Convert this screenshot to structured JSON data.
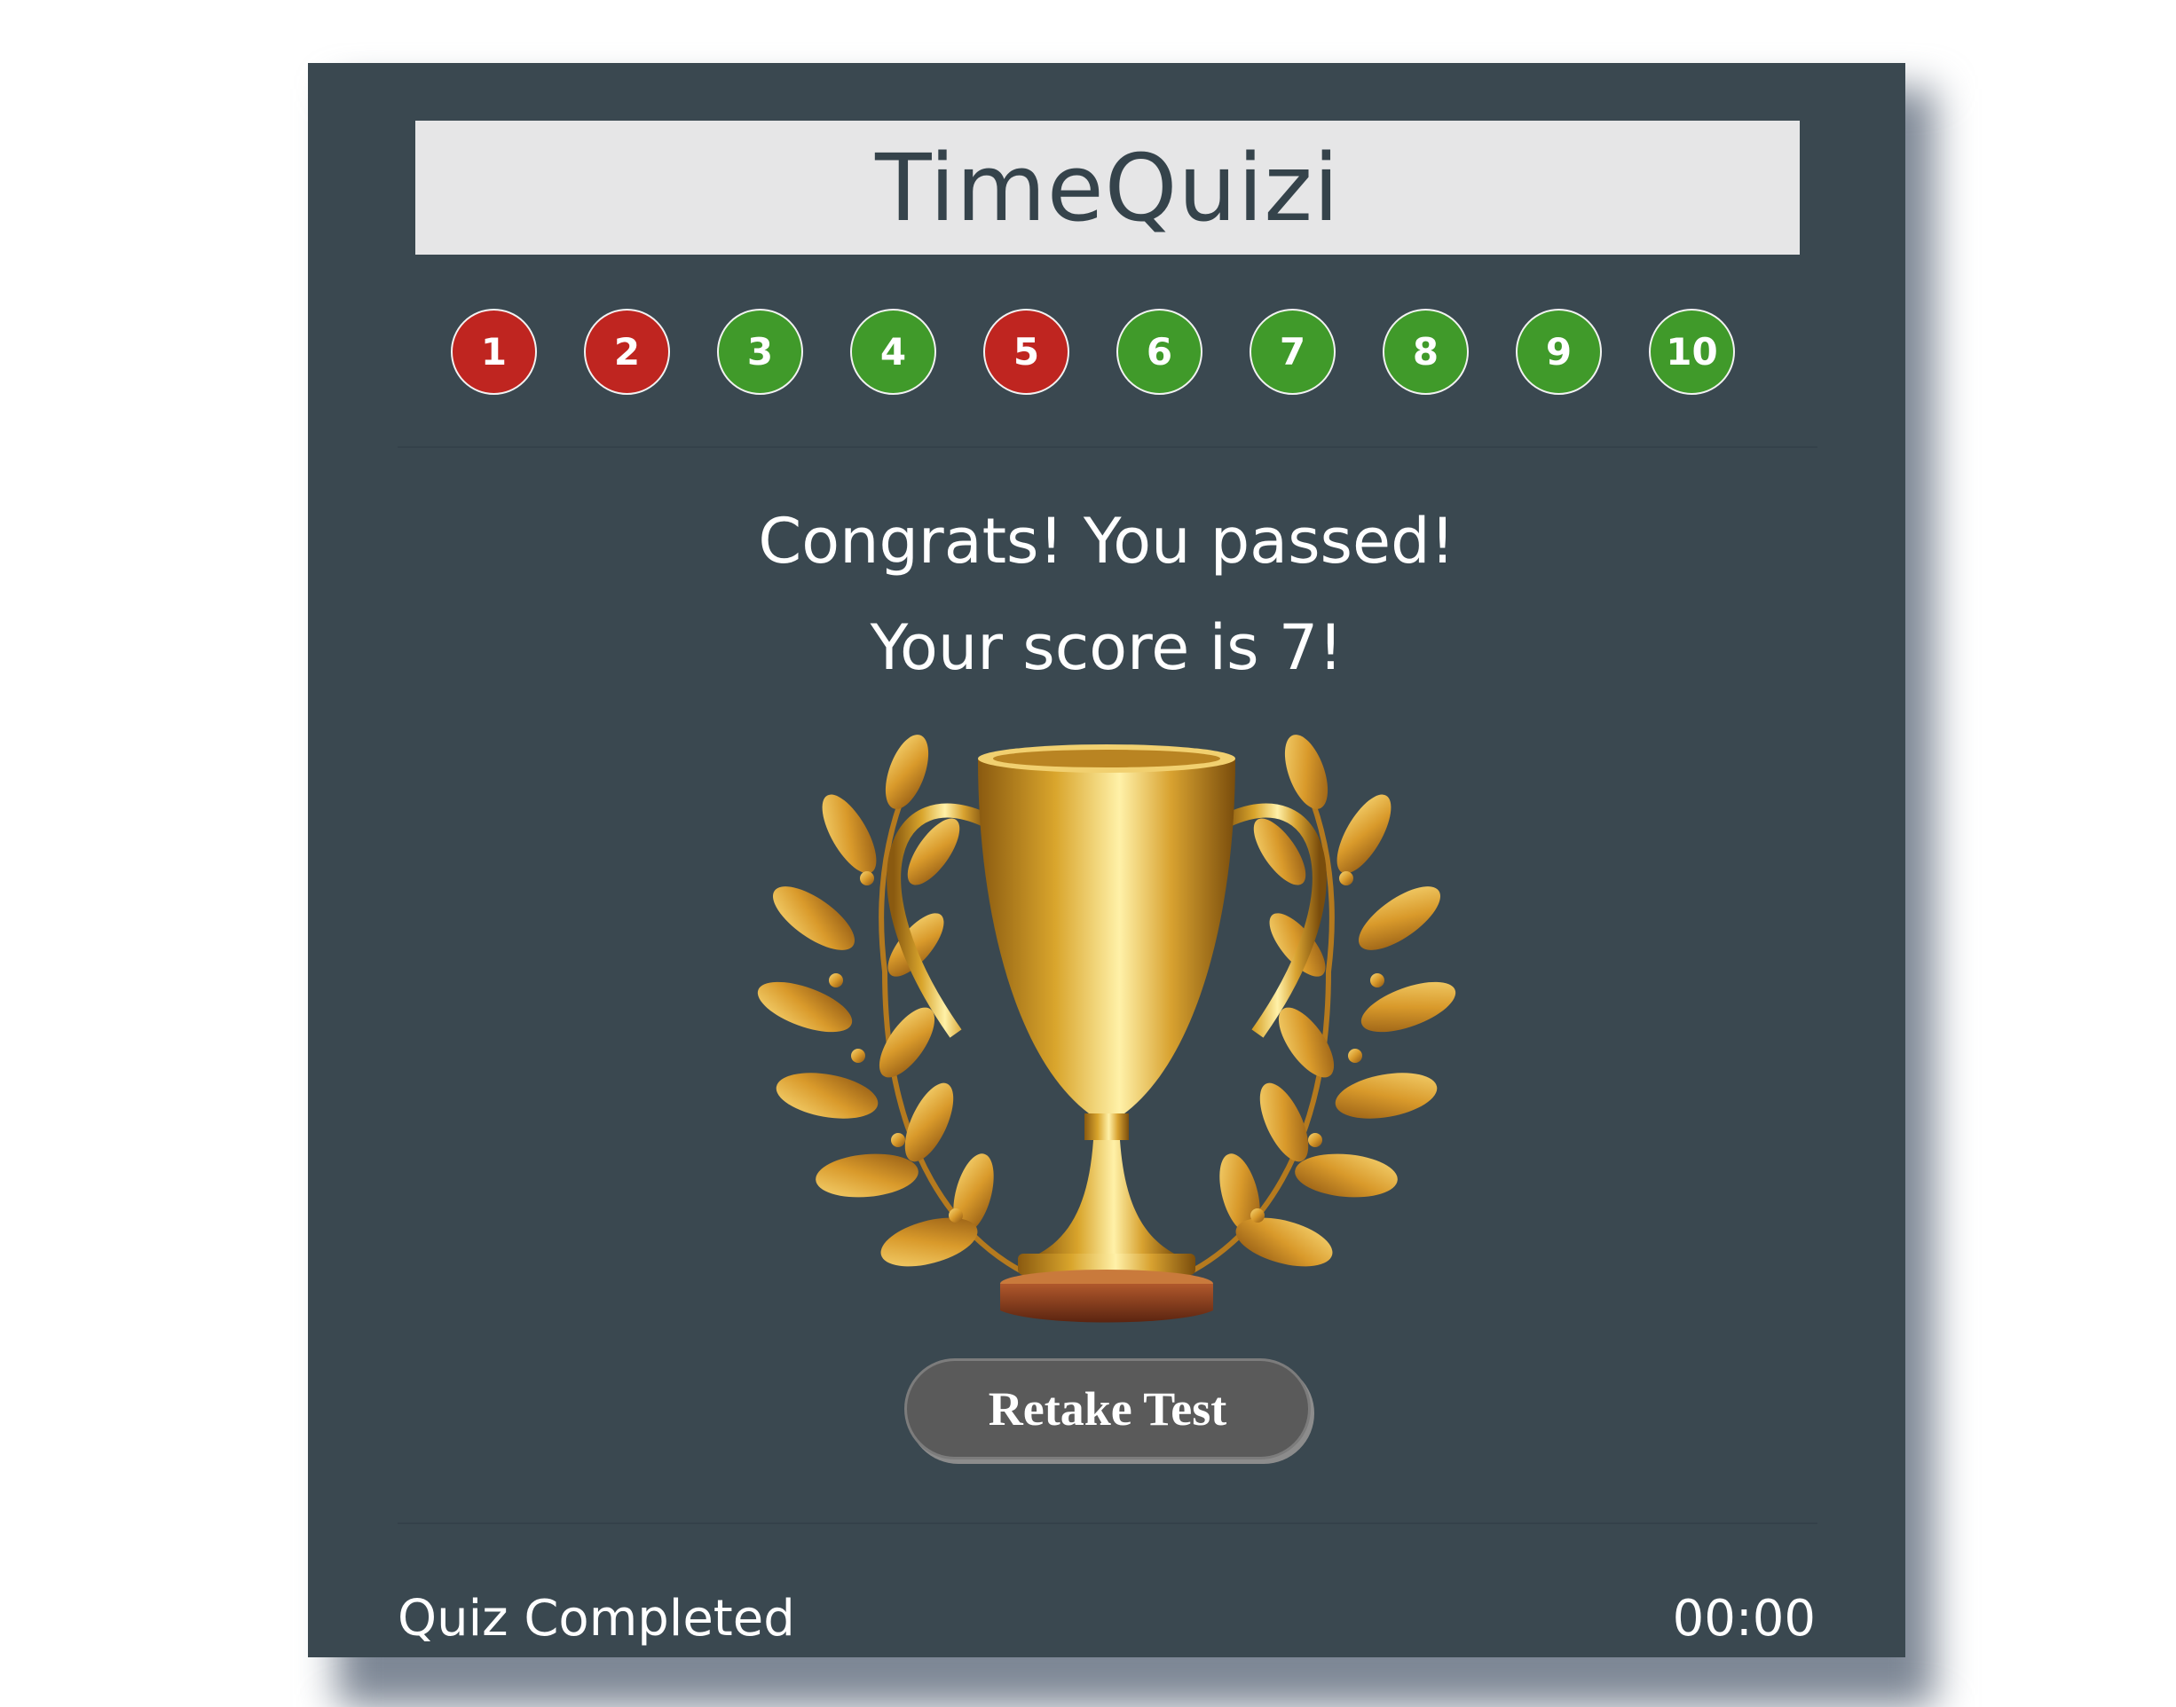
{
  "app": {
    "title": "TimeQuizi"
  },
  "progress": {
    "questions": [
      {
        "label": "1",
        "status": "wrong"
      },
      {
        "label": "2",
        "status": "wrong"
      },
      {
        "label": "3",
        "status": "correct"
      },
      {
        "label": "4",
        "status": "correct"
      },
      {
        "label": "5",
        "status": "wrong"
      },
      {
        "label": "6",
        "status": "correct"
      },
      {
        "label": "7",
        "status": "correct"
      },
      {
        "label": "8",
        "status": "correct"
      },
      {
        "label": "9",
        "status": "correct"
      },
      {
        "label": "10",
        "status": "correct"
      }
    ]
  },
  "result": {
    "headline": "Congrats! You passed!",
    "score_text": "Your score is 7!",
    "image": "trophy-icon"
  },
  "actions": {
    "retake_label": "Retake Test"
  },
  "footer": {
    "status": "Quiz Completed",
    "timer": "00:00"
  },
  "colors": {
    "card_bg": "#3a4850",
    "title_bg": "#e6e6e7",
    "correct": "#409a2a",
    "wrong": "#bf2520",
    "button_bg": "#5a5a5a"
  }
}
